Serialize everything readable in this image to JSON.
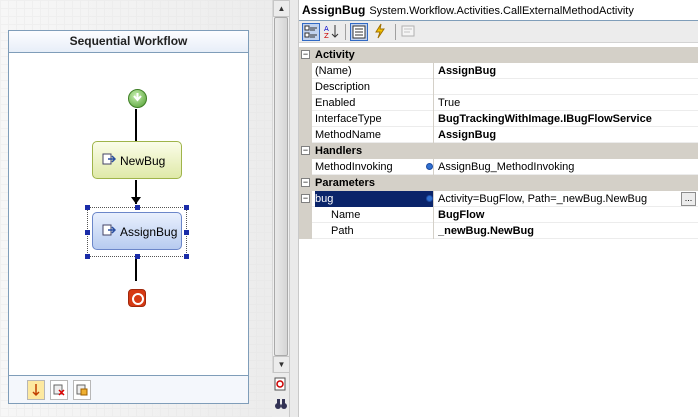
{
  "designer": {
    "title": "Sequential Workflow",
    "activities": [
      {
        "label": "NewBug"
      },
      {
        "label": "AssignBug"
      }
    ]
  },
  "property_grid": {
    "object_name": "AssignBug",
    "object_type": "System.Workflow.Activities.CallExternalMethodActivity",
    "categories": [
      {
        "name": "Activity",
        "rows": [
          {
            "name": "(Name)",
            "value": "AssignBug"
          },
          {
            "name": "Description",
            "value": ""
          },
          {
            "name": "Enabled",
            "value": "True"
          },
          {
            "name": "InterfaceType",
            "value": "BugTrackingWithImage.IBugFlowService"
          },
          {
            "name": "MethodName",
            "value": "AssignBug"
          }
        ]
      },
      {
        "name": "Handlers",
        "rows": [
          {
            "name": "MethodInvoking",
            "value": "AssignBug_MethodInvoking"
          }
        ]
      },
      {
        "name": "Parameters",
        "rows": [
          {
            "name": "bug",
            "value": "Activity=BugFlow, Path=_newBug.NewBug",
            "ellipsis": "..."
          },
          {
            "name": "Name",
            "value": "BugFlow"
          },
          {
            "name": "Path",
            "value": "_newBug.NewBug"
          }
        ]
      }
    ]
  },
  "icons": {
    "categorized": "categorized-icon",
    "alphabetical": "alphabetical-icon",
    "properties": "properties-icon",
    "events": "events-icon",
    "property_pages": "property-pages-icon"
  }
}
